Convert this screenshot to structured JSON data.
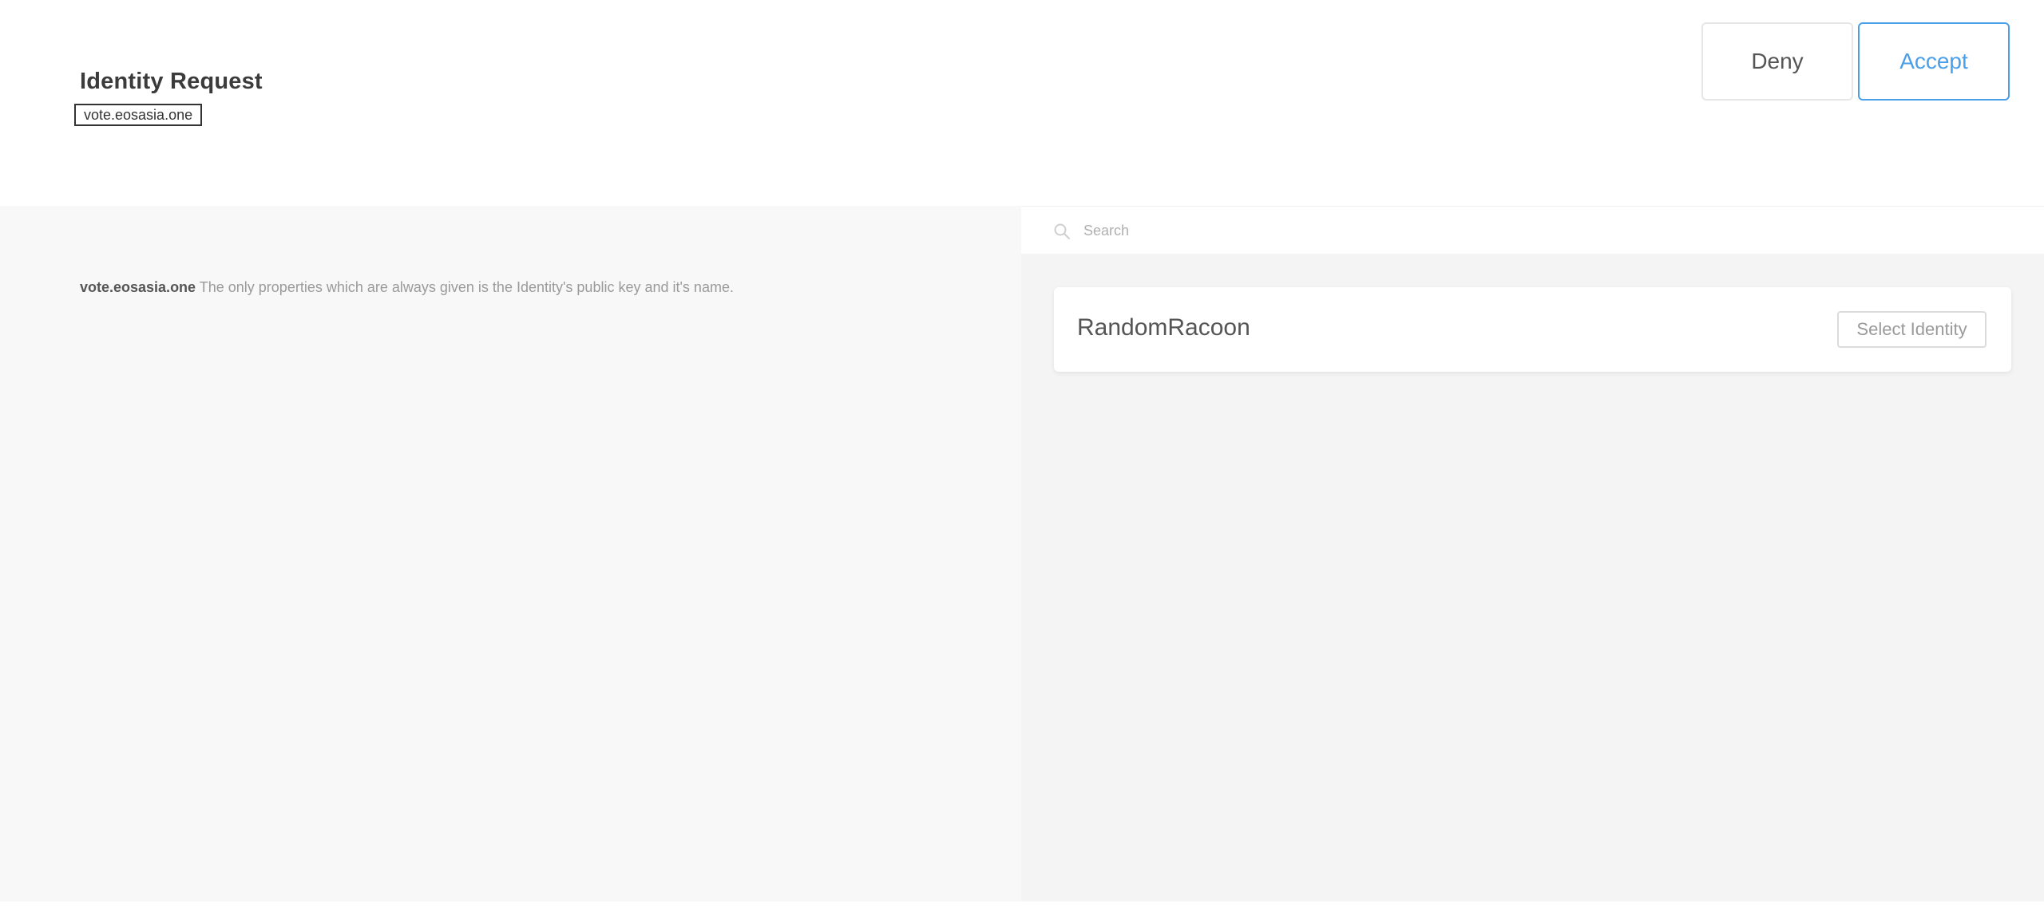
{
  "header": {
    "title": "Identity Request",
    "origin": "vote.eosasia.one",
    "deny_label": "Deny",
    "accept_label": "Accept"
  },
  "colors": {
    "accent": "#4a9fe8",
    "left_panel_bg": "#f8f8f8",
    "right_panel_bg": "#f4f4f4"
  },
  "description": {
    "origin": "vote.eosasia.one",
    "text": " The only properties which are always given is the Identity's public key and it's name."
  },
  "search": {
    "placeholder": "Search",
    "value": "",
    "icon": "search-icon"
  },
  "identities": [
    {
      "name": "RandomRacoon",
      "select_label": "Select Identity"
    }
  ]
}
